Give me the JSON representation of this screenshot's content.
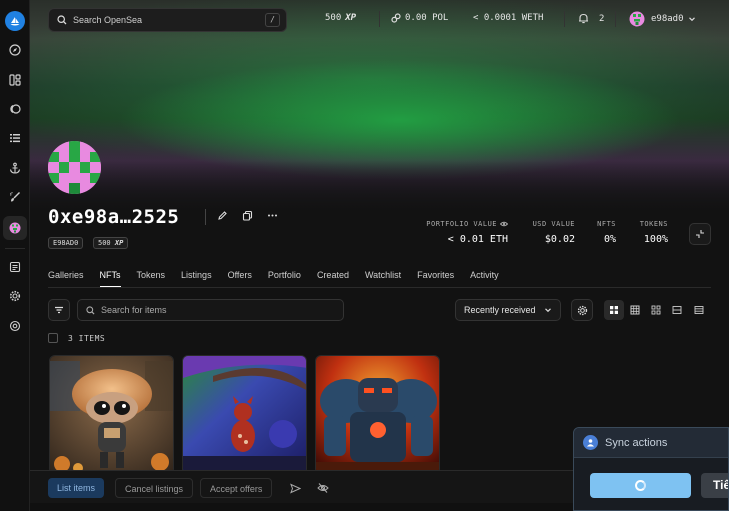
{
  "search": {
    "placeholder": "Search OpenSea",
    "shortcut": "/"
  },
  "topbar": {
    "xp_value": "500",
    "xp_label": "XP",
    "pol_balance": "0.00 POL",
    "weth_balance": "< 0.0001 WETH",
    "notifications_count": "2",
    "username": "e98ad0"
  },
  "sidebar": {
    "items": [
      {
        "icon": "compass-icon"
      },
      {
        "icon": "grid-icon"
      },
      {
        "icon": "token-icon"
      },
      {
        "icon": "list-icon"
      },
      {
        "icon": "anchor-icon"
      },
      {
        "icon": "brush-icon"
      },
      {
        "icon": "profile-icon"
      },
      {
        "icon": "document-icon"
      },
      {
        "icon": "settings-icon"
      },
      {
        "icon": "support-icon"
      }
    ]
  },
  "profile": {
    "address": "0xe98a…2525",
    "badge_name": "E98AD0",
    "badge_xp_value": "500",
    "badge_xp_label": "XP"
  },
  "stats": [
    {
      "label": "PORTFOLIO VALUE",
      "value": "< 0.01 ETH"
    },
    {
      "label": "USD VALUE",
      "value": "$0.02"
    },
    {
      "label": "NFTS",
      "value": "0%"
    },
    {
      "label": "TOKENS",
      "value": "100%"
    }
  ],
  "tabs": [
    "Galleries",
    "NFTs",
    "Tokens",
    "Listings",
    "Offers",
    "Portfolio",
    "Created",
    "Watchlist",
    "Favorites",
    "Activity"
  ],
  "active_tab": "NFTs",
  "filters": {
    "search_placeholder": "Search for items",
    "sort_label": "Recently received"
  },
  "items_count": "3 ITEMS",
  "bottom_bar": {
    "list_items": "List items",
    "cancel_listings": "Cancel listings",
    "accept_offers": "Accept offers"
  },
  "sync": {
    "title": "Sync actions",
    "secondary_label": "Tiế"
  },
  "colors": {
    "accent": "#2081e2",
    "background": "#121212",
    "sync_button": "#7ec2f2"
  }
}
